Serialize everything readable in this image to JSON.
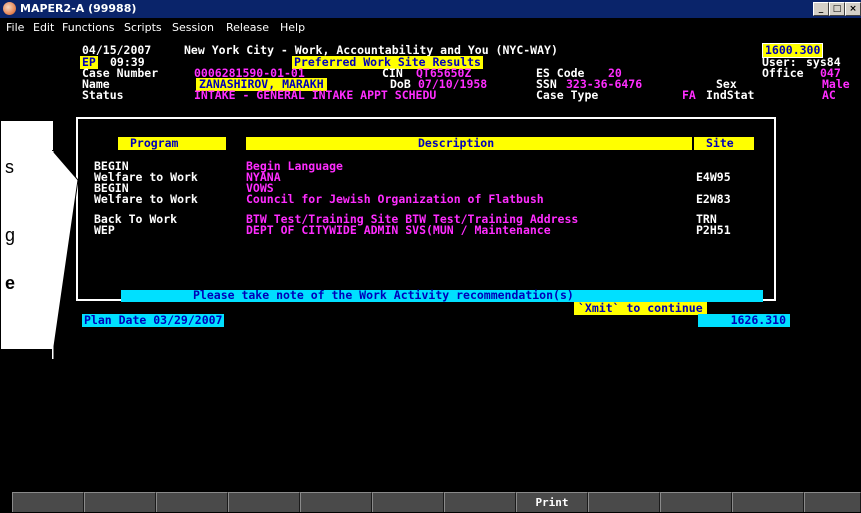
{
  "window": {
    "title": "MAPER2-A (99988)",
    "minimize": "_",
    "maximize": "□",
    "close": "×"
  },
  "menu": [
    "File",
    "Edit",
    "Functions",
    "Scripts",
    "Session",
    "Release",
    "Help"
  ],
  "header": {
    "date": "04/15/2007",
    "mode": "EP",
    "time": "09:39",
    "system_title": "New York City - Work, Accountability and You (NYC-WAY)",
    "screen_code": "1600.300",
    "screen_title": "Preferred Work Site Results",
    "user_label": "User:",
    "user_value": "sys84",
    "case_number_label": "Case Number",
    "case_number_value": "0006281590-01-01",
    "cin_label": "CIN",
    "cin_value": "QT65650Z",
    "es_code_label": "ES Code",
    "es_code_value": "20",
    "office_label": "Office",
    "office_value": "047",
    "name_label": "Name",
    "name_value": "ZANASHIROV, MARAKH",
    "dob_label": "DoB",
    "dob_value": "07/10/1958",
    "ssn_label": "SSN",
    "ssn_value": "323-36-6476",
    "sex_label": "Sex",
    "sex_value": "Male",
    "status_label": "Status",
    "status_value": "INTAKE - GENERAL INTAKE APPT SCHEDU",
    "case_type_label": "Case Type",
    "case_type_value": "FA",
    "indstat_label": "IndStat",
    "indstat_value": "AC"
  },
  "table": {
    "columns": [
      "Program",
      "Description",
      "Site"
    ],
    "rows": [
      {
        "program": "BEGIN",
        "description": "Begin Language",
        "site": ""
      },
      {
        "program": "Welfare to Work",
        "description": "NYANA",
        "site": "E4W95"
      },
      {
        "program": "BEGIN",
        "description": "VOWS",
        "site": ""
      },
      {
        "program": "Welfare to Work",
        "description": "Council for Jewish Organization of Flatbush",
        "site": "E2W83"
      },
      {
        "program": "Back To Work",
        "description": "BTW Test/Training Site BTW Test/Training Address",
        "site": "TRN"
      },
      {
        "program": "WEP",
        "description": "DEPT OF CITYWIDE ADMIN SVS(MUN / Maintenance",
        "site": "P2H51"
      }
    ]
  },
  "footer": {
    "note": "Please take note of the Work Activity recommendation(s)",
    "xmit": "`Xmit` to continue",
    "plan_date": "Plan Date 03/29/2007",
    "screen_id": "1626.310"
  },
  "fkeys": [
    "",
    "",
    "",
    "",
    "",
    "",
    "",
    "Print",
    "",
    "",
    "",
    ""
  ],
  "callout": {
    "line1": "s",
    "line2": "g",
    "line3": "e"
  },
  "colors": {
    "background": "#000000",
    "label": "#ffffff",
    "value": "#ff2dff",
    "highlight": "#ffff00",
    "note_bar": "#00e0ff",
    "title_bar": "#0a246a"
  }
}
